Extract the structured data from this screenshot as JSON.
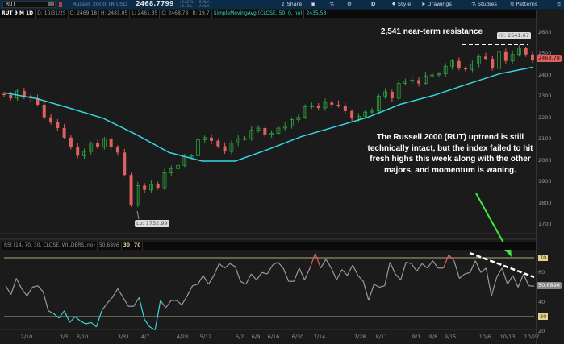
{
  "toolbar": {
    "symbol": "RUT",
    "name": "Russell 2000 TR USD",
    "price": "2468.7799",
    "change": "+2.8271",
    "change_pct": "+0.11%",
    "bid": "B: N/A",
    "ask": "A: N/A",
    "share": "Share",
    "period": "D",
    "style": "Style",
    "drawings": "Drawings",
    "studies": "Studies",
    "patterns": "Patterns"
  },
  "info": {
    "title": "RUT 9 M 1D",
    "date": "D: 10/31/25",
    "open": "O: 2469.18",
    "high": "H: 2481.05",
    "low": "L: 2461.35",
    "close": "C: 2468.78",
    "range": "R: 19.7",
    "study": "SimpleMovingAvg (CLOSE, 50, 0, no)",
    "study_value": "2435.53"
  },
  "rsi_header": {
    "label": "RSI (14, 70, 30, CLOSE, WILDERS, no)",
    "value": "50.6896",
    "low": "30",
    "high": "70"
  },
  "annotations": {
    "resistance": "2,541 near-term resistance",
    "hi": "Hi: 2541.67",
    "lo": "Lo: 1732.99",
    "last": "2468.78",
    "rsi_last": "50.6896",
    "commentary": "The Russell 2000 (RUT) uptrend is still technically intact, but the index failed to hit fresh highs this week along with the other majors, and momentum is waning."
  },
  "colors": {
    "up": "#2e9e3e",
    "down": "#e0605f",
    "sma": "#35d6e0",
    "rsi": "#9a9a9a",
    "rsi_oversold": "#35d6e0",
    "rsi_overbought": "#e0605f",
    "arrow": "#3ee83e"
  },
  "chart_data": [
    {
      "type": "candlestick",
      "ylim": [
        1650,
        2650
      ],
      "y_ticks": [
        "2600",
        "2500",
        "2400",
        "2300",
        "2200",
        "2100",
        "2000",
        "1900",
        "1800",
        "1700"
      ],
      "x_ticks": [
        "2/10",
        "3/3",
        "3/10",
        "3/31",
        "4/7",
        "4/28",
        "5/12",
        "6/2",
        "6/9",
        "6/16",
        "6/30",
        "7/14",
        "7/28",
        "8/11",
        "9/1",
        "9/8",
        "9/15",
        "10/6",
        "10/13",
        "10/27"
      ],
      "closes": [
        2305,
        2290,
        2324,
        2300,
        2290,
        2260,
        2200,
        2180,
        2150,
        2105,
        2060,
        2020,
        2040,
        2080,
        2060,
        2100,
        2060,
        2035,
        1930,
        1790,
        1880,
        1860,
        1885,
        1870,
        1940,
        1960,
        1975,
        2014,
        2020,
        2095,
        2105,
        2090,
        2065,
        2040,
        2080,
        2100,
        2100,
        2140,
        2150,
        2120,
        2125,
        2150,
        2160,
        2190,
        2200,
        2250,
        2255,
        2245,
        2270,
        2260,
        2255,
        2230,
        2195,
        2205,
        2225,
        2230,
        2300,
        2320,
        2290,
        2360,
        2370,
        2375,
        2360,
        2395,
        2400,
        2405,
        2440,
        2465,
        2430,
        2425,
        2450,
        2485,
        2475,
        2430,
        2510,
        2465,
        2495,
        2525,
        2495,
        2468.78
      ],
      "sma50": [
        2316,
        2288,
        2243,
        2196,
        2120,
        2035,
        1995,
        1995,
        2050,
        2110,
        2155,
        2200,
        2262,
        2303,
        2355,
        2405,
        2435.53
      ],
      "high": 2541.67,
      "low": 1732.99,
      "resistance": 2541
    },
    {
      "type": "line",
      "name": "RSI",
      "ylim": [
        20,
        80
      ],
      "levels": [
        30,
        70
      ],
      "y_ticks": [
        "70",
        "60",
        "40",
        "30",
        "20"
      ],
      "values": [
        51,
        45,
        56,
        49,
        44,
        50,
        51,
        47,
        34,
        32,
        29,
        34,
        26,
        30,
        27,
        25,
        26,
        23,
        34,
        39,
        43,
        49,
        43,
        37,
        37,
        43,
        28,
        23,
        21,
        41,
        36,
        41,
        41,
        38,
        44,
        51,
        52,
        58,
        52,
        58,
        66,
        63,
        66,
        64,
        54,
        52,
        59,
        55,
        60,
        59,
        65,
        67,
        63,
        54,
        54,
        63,
        55,
        63,
        73,
        63,
        69,
        63,
        55,
        62,
        58,
        65,
        58,
        54,
        41,
        52,
        50,
        51,
        67,
        59,
        55,
        67,
        66,
        61,
        66,
        63,
        68,
        63,
        63,
        72,
        68,
        56,
        59,
        60,
        68,
        60,
        63,
        44,
        57,
        63,
        52,
        58,
        50,
        59,
        51,
        50.69
      ]
    }
  ]
}
